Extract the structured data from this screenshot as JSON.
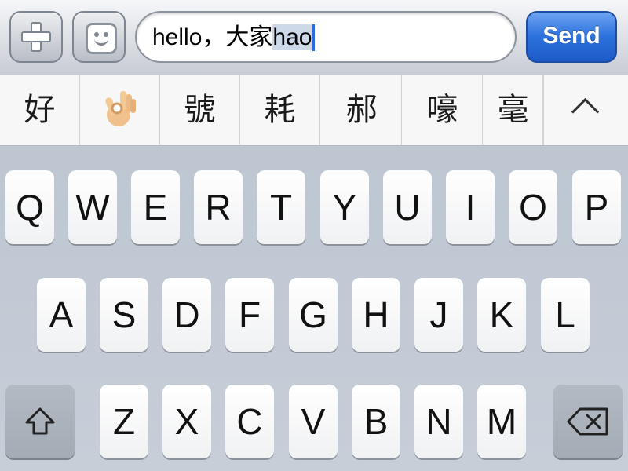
{
  "input_bar": {
    "plus_icon": "plus-icon",
    "emoji_icon": "smiley-icon",
    "text_committed": "hello，大家",
    "text_marked": "hao",
    "send_label": "Send",
    "send_color": "#2b70dc"
  },
  "candidates": [
    "好",
    "👌",
    "號",
    "耗",
    "郝",
    "嚎",
    "毫"
  ],
  "expand_icon": "chevron-up-icon",
  "keyboard": {
    "row1": [
      "Q",
      "W",
      "E",
      "R",
      "T",
      "Y",
      "U",
      "I",
      "O",
      "P"
    ],
    "row2": [
      "A",
      "S",
      "D",
      "F",
      "G",
      "H",
      "J",
      "K",
      "L"
    ],
    "row3": [
      "Z",
      "X",
      "C",
      "V",
      "B",
      "N",
      "M"
    ],
    "shift_icon": "shift-icon",
    "backspace_icon": "backspace-icon"
  }
}
